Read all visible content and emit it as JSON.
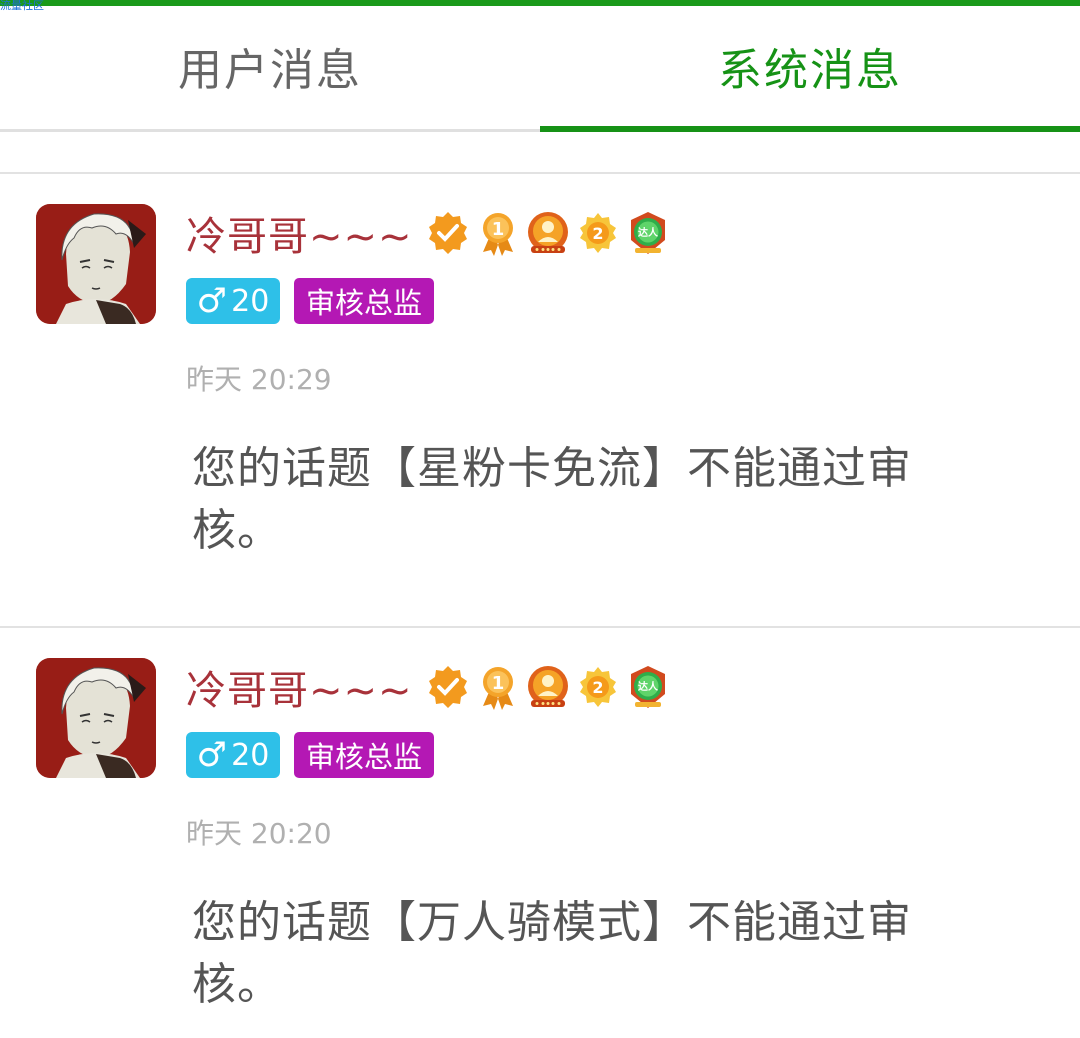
{
  "status_text": "流量社区",
  "tabs": [
    {
      "label": "用户消息",
      "active": false
    },
    {
      "label": "系统消息",
      "active": true
    }
  ],
  "accent_color": "#169216",
  "messages": [
    {
      "sender": "冷哥哥~~~",
      "gender": "♂",
      "age": "20",
      "role": "审核总监",
      "time": "昨天 20:29",
      "text": "您的话题【星粉卡免流】不能通过审核。",
      "badges": [
        "verified-icon",
        "rank-1-medal-icon",
        "crown-medal-icon",
        "level-2-icon",
        "expert-badge-icon"
      ]
    },
    {
      "sender": "冷哥哥~~~",
      "gender": "♂",
      "age": "20",
      "role": "审核总监",
      "time": "昨天 20:20",
      "text": "您的话题【万人骑模式】不能通过审核。",
      "badges": [
        "verified-icon",
        "rank-1-medal-icon",
        "crown-medal-icon",
        "level-2-icon",
        "expert-badge-icon"
      ]
    }
  ],
  "badge_labels": {
    "rank": "1",
    "level": "2",
    "expert": "达人"
  }
}
